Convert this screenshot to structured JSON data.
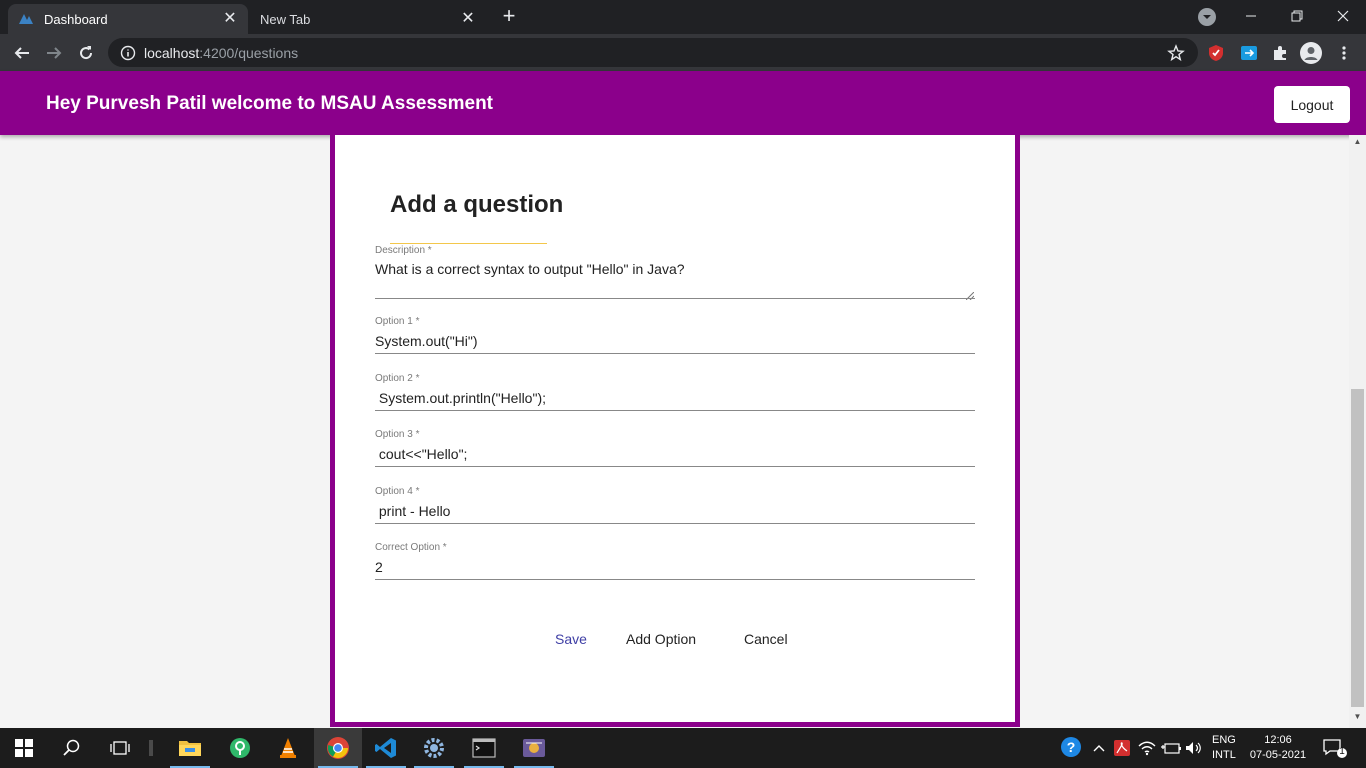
{
  "browser": {
    "tabs": [
      {
        "title": "Dashboard",
        "active": true
      },
      {
        "title": "New Tab",
        "active": false
      }
    ],
    "url_host": "localhost",
    "url_path": ":4200/questions"
  },
  "header": {
    "title": "Hey Purvesh Patil welcome to MSAU Assessment",
    "logout_label": "Logout"
  },
  "form": {
    "title": "Add a question",
    "fields": [
      {
        "label": "Description *",
        "value": "What is a correct syntax to output \"Hello\" in Java?"
      },
      {
        "label": "Option 1 *",
        "value": "System.out(\"Hi\")"
      },
      {
        "label": "Option 2 *",
        "value": " System.out.println(\"Hello\");"
      },
      {
        "label": "Option 3 *",
        "value": " cout<<\"Hello\";"
      },
      {
        "label": "Option 4 *",
        "value": " print - Hello"
      },
      {
        "label": "Correct Option *",
        "value": "2"
      }
    ],
    "actions": {
      "save": "Save",
      "add_option": "Add Option",
      "cancel": "Cancel"
    }
  },
  "taskbar": {
    "language": "ENG",
    "layout": "INTL",
    "time": "12:06",
    "date": "07-05-2021",
    "notification_count": "1"
  },
  "colors": {
    "brand": "#8b008b",
    "accent_underline": "#f3c74b",
    "save_text": "#3f3fa5"
  }
}
